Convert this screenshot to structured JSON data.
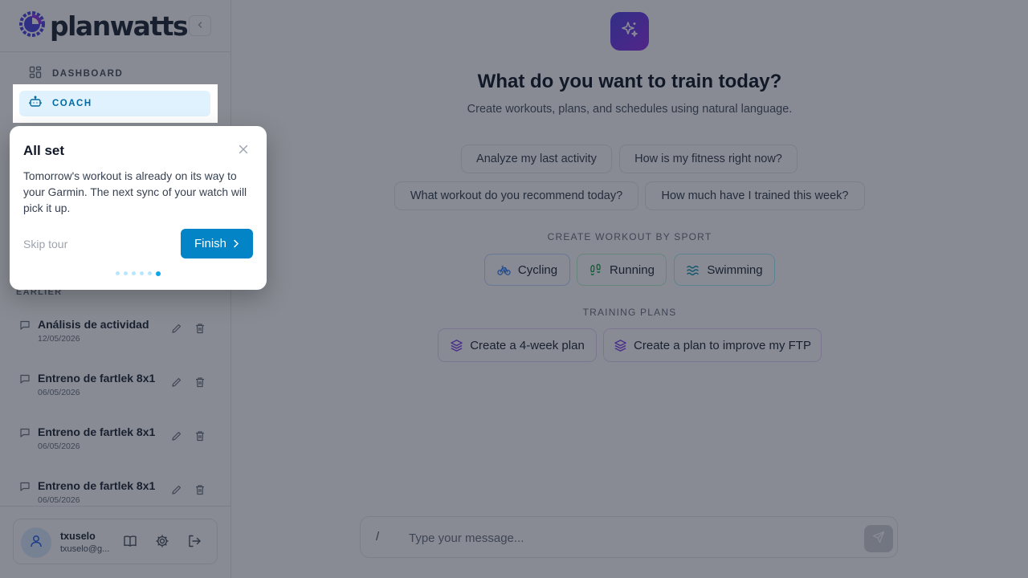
{
  "brand": {
    "name": "planwatts"
  },
  "sidebar": {
    "nav": [
      {
        "label": "DASHBOARD",
        "icon": "grid-icon"
      },
      {
        "label": "COACH",
        "icon": "bot-icon"
      }
    ],
    "section_label": "EARLIER",
    "conversations": [
      {
        "title": "Análisis de actividad",
        "date": "12/05/2026"
      },
      {
        "title": "Entreno de fartlek 8x1",
        "date": "06/05/2026"
      },
      {
        "title": "Entreno de fartlek 8x1",
        "date": "06/05/2026"
      },
      {
        "title": "Entreno de fartlek 8x1",
        "date": "06/05/2026"
      }
    ],
    "user": {
      "name": "txuselo",
      "email": "txuselo@g..."
    }
  },
  "main": {
    "headline": "What do you want to train today?",
    "subline": "Create workouts, plans, and schedules using natural language.",
    "suggestions": [
      "Analyze my last activity",
      "How is my fitness right now?",
      "What workout do you recommend today?",
      "How much have I trained this week?"
    ],
    "sport_label": "CREATE WORKOUT BY SPORT",
    "sports": [
      {
        "label": "Cycling",
        "icon": "bike-icon",
        "color": "#3b82f6"
      },
      {
        "label": "Running",
        "icon": "footprints-icon",
        "color": "#16a34a"
      },
      {
        "label": "Swimming",
        "icon": "waves-icon",
        "color": "#0891b2"
      }
    ],
    "plans_label": "TRAINING PLANS",
    "plans": [
      {
        "label": "Create a 4-week plan",
        "icon": "layers-icon"
      },
      {
        "label": "Create a plan to improve my FTP",
        "icon": "layers-icon"
      }
    ],
    "composer": {
      "slash": "/",
      "placeholder": "Type your message..."
    }
  },
  "tour": {
    "title": "All set",
    "body": "Tomorrow's workout is already on its way to your Garmin. The next sync of your watch will pick it up.",
    "skip": "Skip tour",
    "finish": "Finish",
    "step": 6,
    "total_steps": 6
  },
  "colors": {
    "accent": "#0284c7",
    "nav_active_bg": "#e0f2fe",
    "purple": "#7c3aed"
  }
}
